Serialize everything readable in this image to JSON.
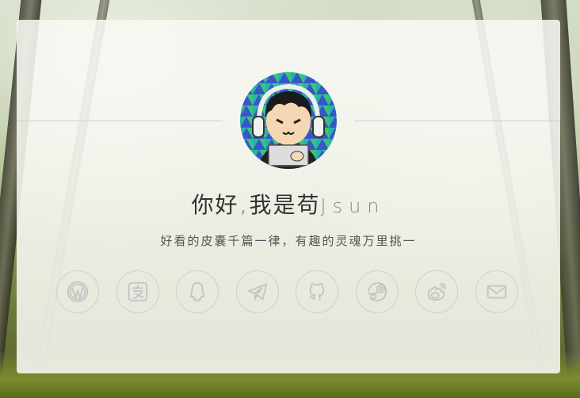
{
  "greeting": {
    "hello": "你好",
    "comma": ",",
    "intro": "我是苟",
    "name": "Jsun"
  },
  "subtitle": "好看的皮囊千篇一律，有趣的灵魂万里挑一",
  "socials": [
    {
      "icon": "wordpress-icon"
    },
    {
      "icon": "alipay-icon"
    },
    {
      "icon": "qq-icon"
    },
    {
      "icon": "telegram-icon"
    },
    {
      "icon": "github-icon"
    },
    {
      "icon": "steam-icon"
    },
    {
      "icon": "weibo-icon"
    },
    {
      "icon": "mail-icon"
    }
  ],
  "colors": {
    "card_bg": "#f8f8f4",
    "icon_stroke": "#c4c4c4",
    "avatar_bg": "#2fb7a8"
  }
}
